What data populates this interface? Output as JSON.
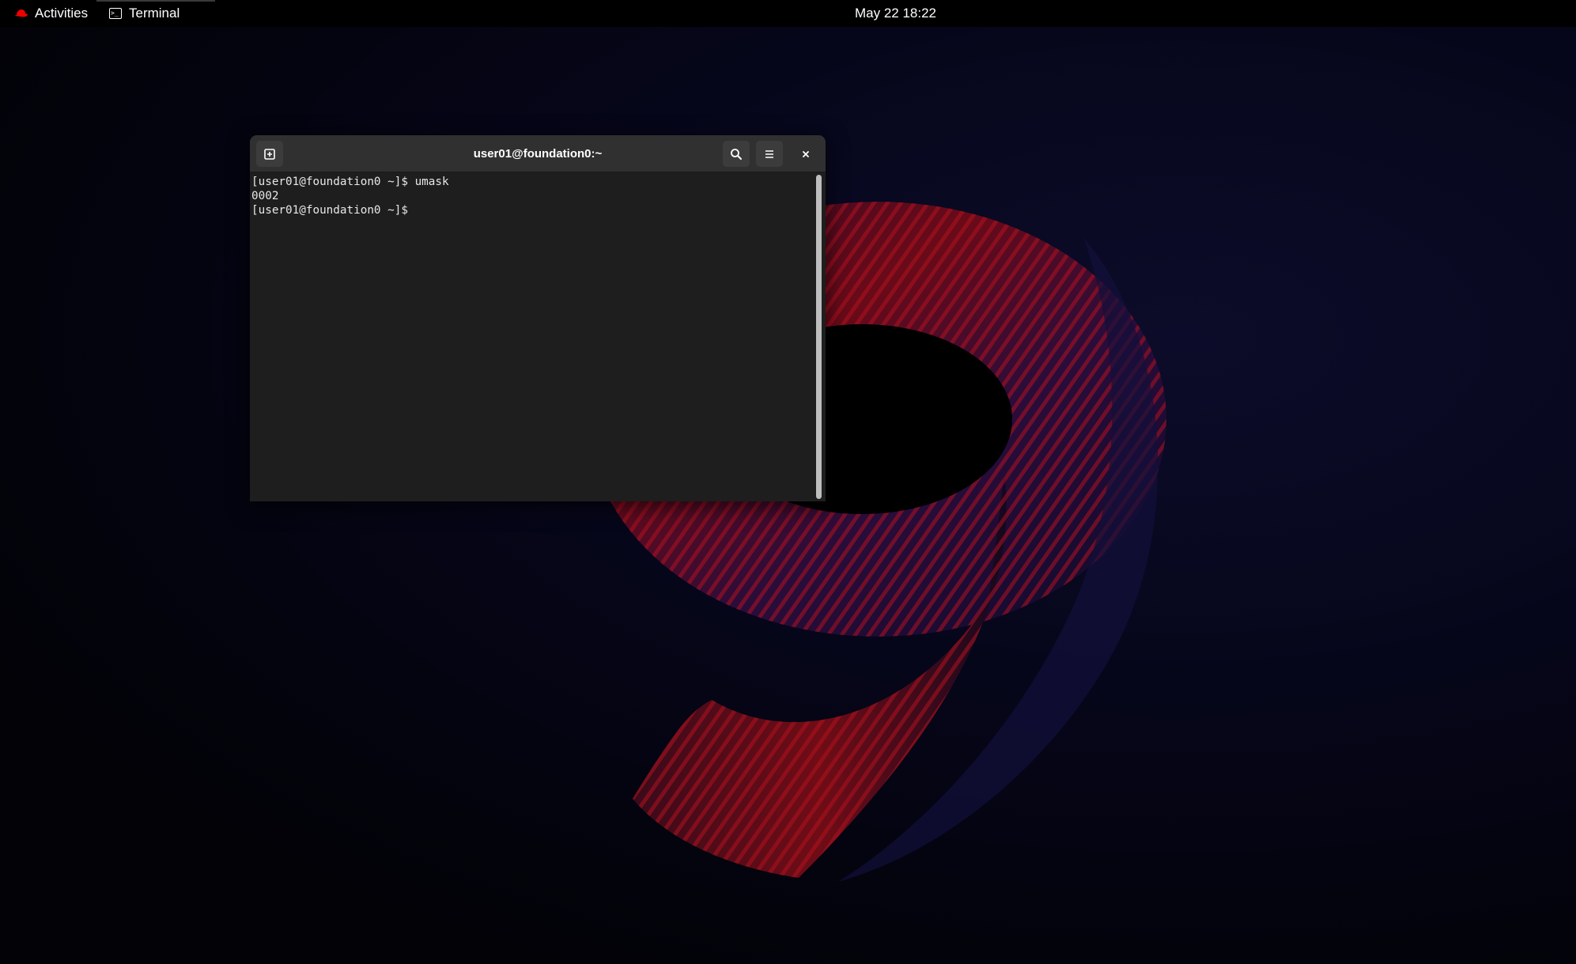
{
  "topbar": {
    "activities_label": "Activities",
    "app_label": "Terminal",
    "clock": "May 22  18:22"
  },
  "terminal": {
    "title": "user01@foundation0:~",
    "lines": [
      "[user01@foundation0 ~]$ umask",
      "0002",
      "[user01@foundation0 ~]$ "
    ],
    "icons": {
      "new_tab": "new-tab-icon",
      "search": "search-icon",
      "menu": "hamburger-menu-icon",
      "close": "close-icon"
    }
  },
  "colors": {
    "topbar_bg": "#000000",
    "terminal_bg": "#1e1e1e",
    "headerbar_bg": "#303030",
    "wallpaper_accent": "#c8102e"
  }
}
